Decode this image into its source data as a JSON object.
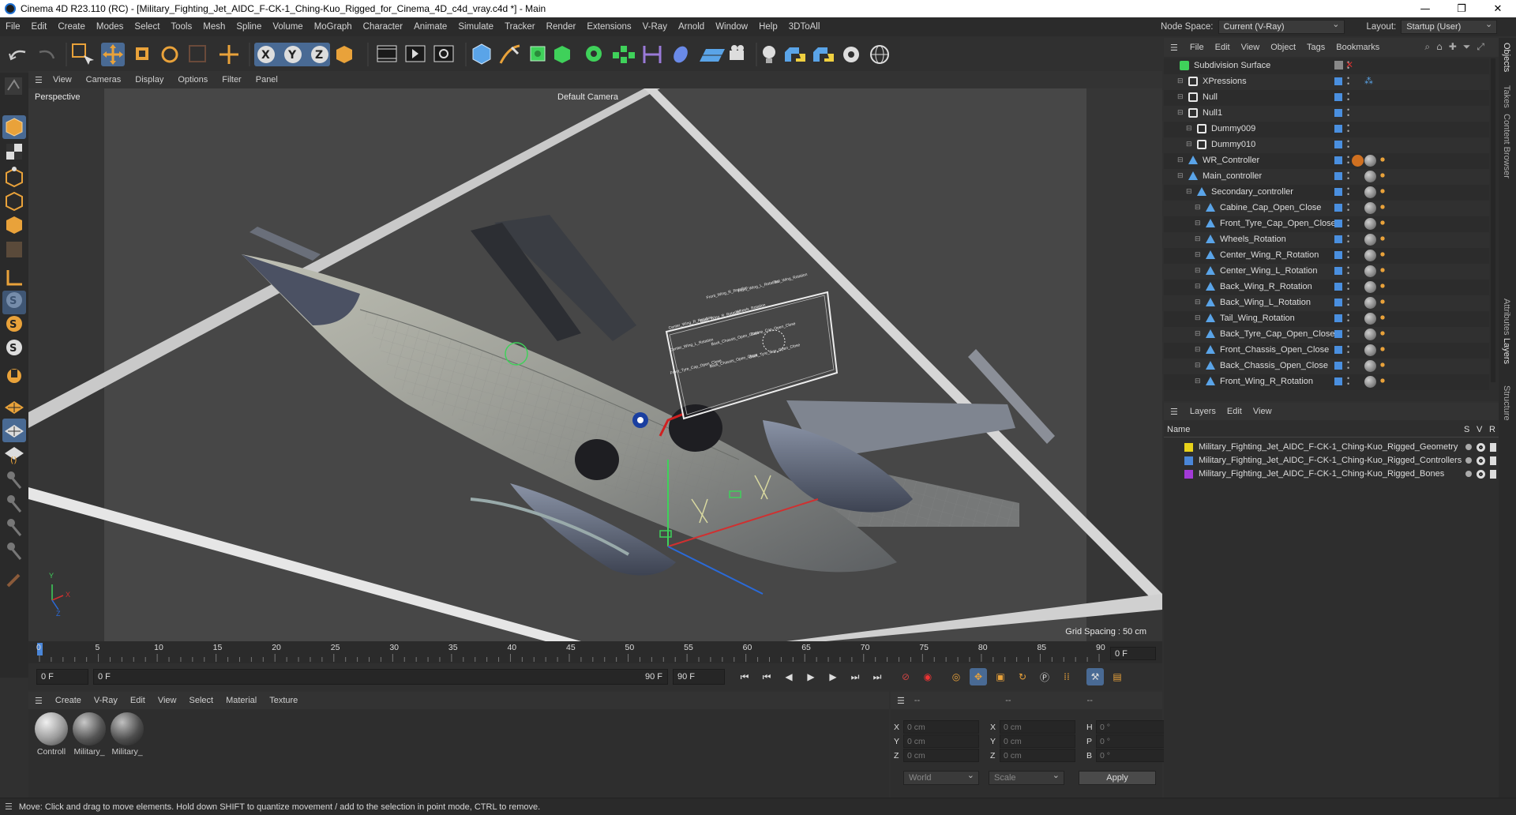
{
  "window": {
    "title": "Cinema 4D R23.110 (RC) - [Military_Fighting_Jet_AIDC_F-CK-1_Ching-Kuo_Rigged_for_Cinema_4D_c4d_vray.c4d *] - Main",
    "minimize": "—",
    "maximize": "❐",
    "close": "✕"
  },
  "menubar": {
    "items": [
      "File",
      "Edit",
      "Create",
      "Modes",
      "Select",
      "Tools",
      "Mesh",
      "Spline",
      "Volume",
      "MoGraph",
      "Character",
      "Animate",
      "Simulate",
      "Tracker",
      "Render",
      "Extensions",
      "V-Ray",
      "Arnold",
      "Window",
      "Help",
      "3DToAll"
    ],
    "node_space_label": "Node Space:",
    "node_space_value": "Current (V-Ray)",
    "layout_label": "Layout:",
    "layout_value": "Startup (User)"
  },
  "viewport": {
    "menu": [
      "View",
      "Cameras",
      "Display",
      "Options",
      "Filter",
      "Panel"
    ],
    "label": "Perspective",
    "camera": "Default Camera",
    "grid_spacing": "Grid Spacing : 50 cm",
    "axis_x": "X",
    "axis_y": "Y",
    "axis_z": "Z",
    "ctrl_labels": [
      "Front_Wing_R_Rotation",
      "Front_Wing_L_Rotation",
      "Tail_Wing_Rotation",
      "Center_Wing_R_Rotation",
      "Back_Wing_R_Rotation",
      "Wheels_Rotation",
      "Center_Wing_L_Rotation",
      "Back_Chassis_Open_Close",
      "Cabine_Cap_Open_Close",
      "Front_Tyre_Cap_Open_Close",
      "Back_Chassis_Open_Close",
      "Back_Tyre_Cap_Open_Close"
    ]
  },
  "timeline": {
    "ticks": [
      "0",
      "5",
      "10",
      "15",
      "20",
      "25",
      "30",
      "35",
      "40",
      "45",
      "50",
      "55",
      "60",
      "65",
      "70",
      "75",
      "80",
      "85",
      "90"
    ],
    "current_frame": "0 F",
    "start_field": "0 F",
    "range_start": "0 F",
    "range_end": "90 F",
    "end_field": "90 F",
    "right_field": "0 F"
  },
  "materials": {
    "menu": [
      "Create",
      "V-Ray",
      "Edit",
      "View",
      "Select",
      "Material",
      "Texture"
    ],
    "items": [
      {
        "name": "Controll"
      },
      {
        "name": "Military_"
      },
      {
        "name": "Military_"
      }
    ]
  },
  "coords": {
    "headers": [
      "--",
      "--",
      "--"
    ],
    "rows": [
      {
        "a": "X",
        "av": "0 cm",
        "b": "X",
        "bv": "0 cm",
        "c": "H",
        "cv": "0 °"
      },
      {
        "a": "Y",
        "av": "0 cm",
        "b": "Y",
        "bv": "0 cm",
        "c": "P",
        "cv": "0 °"
      },
      {
        "a": "Z",
        "av": "0 cm",
        "b": "Z",
        "bv": "0 cm",
        "c": "B",
        "cv": "0 °"
      }
    ],
    "space": "World",
    "mode": "Scale",
    "apply": "Apply"
  },
  "status": {
    "text": "Move: Click and drag to move elements. Hold down SHIFT to quantize movement / add to the selection in point mode, CTRL to remove."
  },
  "object_manager": {
    "menu": [
      "File",
      "Edit",
      "View",
      "Object",
      "Tags",
      "Bookmarks"
    ],
    "objects": [
      {
        "name": "Subdivision Surface",
        "depth": 0,
        "type": "subd"
      },
      {
        "name": "XPressions",
        "depth": 1,
        "type": "null"
      },
      {
        "name": "Null",
        "depth": 1,
        "type": "null"
      },
      {
        "name": "Null1",
        "depth": 1,
        "type": "null"
      },
      {
        "name": "Dummy009",
        "depth": 2,
        "type": "null"
      },
      {
        "name": "Dummy010",
        "depth": 2,
        "type": "null"
      },
      {
        "name": "WR_Controller",
        "depth": 1,
        "type": "joint"
      },
      {
        "name": "Main_controller",
        "depth": 1,
        "type": "joint"
      },
      {
        "name": "Secondary_controller",
        "depth": 2,
        "type": "joint"
      },
      {
        "name": "Cabine_Cap_Open_Close",
        "depth": 3,
        "type": "joint"
      },
      {
        "name": "Front_Tyre_Cap_Open_Close",
        "depth": 3,
        "type": "joint"
      },
      {
        "name": "Wheels_Rotation",
        "depth": 3,
        "type": "joint"
      },
      {
        "name": "Center_Wing_R_Rotation",
        "depth": 3,
        "type": "joint"
      },
      {
        "name": "Center_Wing_L_Rotation",
        "depth": 3,
        "type": "joint"
      },
      {
        "name": "Back_Wing_R_Rotation",
        "depth": 3,
        "type": "joint"
      },
      {
        "name": "Back_Wing_L_Rotation",
        "depth": 3,
        "type": "joint"
      },
      {
        "name": "Tail_Wing_Rotation",
        "depth": 3,
        "type": "joint"
      },
      {
        "name": "Back_Tyre_Cap_Open_Close",
        "depth": 3,
        "type": "joint"
      },
      {
        "name": "Front_Chassis_Open_Close",
        "depth": 3,
        "type": "joint"
      },
      {
        "name": "Back_Chassis_Open_Close",
        "depth": 3,
        "type": "joint"
      },
      {
        "name": "Front_Wing_R_Rotation",
        "depth": 3,
        "type": "joint"
      }
    ]
  },
  "layers": {
    "menu": [
      "Layers",
      "Edit",
      "View"
    ],
    "head_name": "Name",
    "head_s": "S",
    "head_v": "V",
    "head_r": "R",
    "items": [
      {
        "name": "Military_Fighting_Jet_AIDC_F-CK-1_Ching-Kuo_Rigged_Geometry",
        "color": "#e8d21a"
      },
      {
        "name": "Military_Fighting_Jet_AIDC_F-CK-1_Ching-Kuo_Rigged_Controllers",
        "color": "#4a86d8"
      },
      {
        "name": "Military_Fighting_Jet_AIDC_F-CK-1_Ching-Kuo_Rigged_Bones",
        "color": "#a23ad6"
      }
    ]
  },
  "right_tabs": [
    "Objects",
    "Takes",
    "Content Browser",
    "Attributes",
    "Layers",
    "Structure"
  ]
}
